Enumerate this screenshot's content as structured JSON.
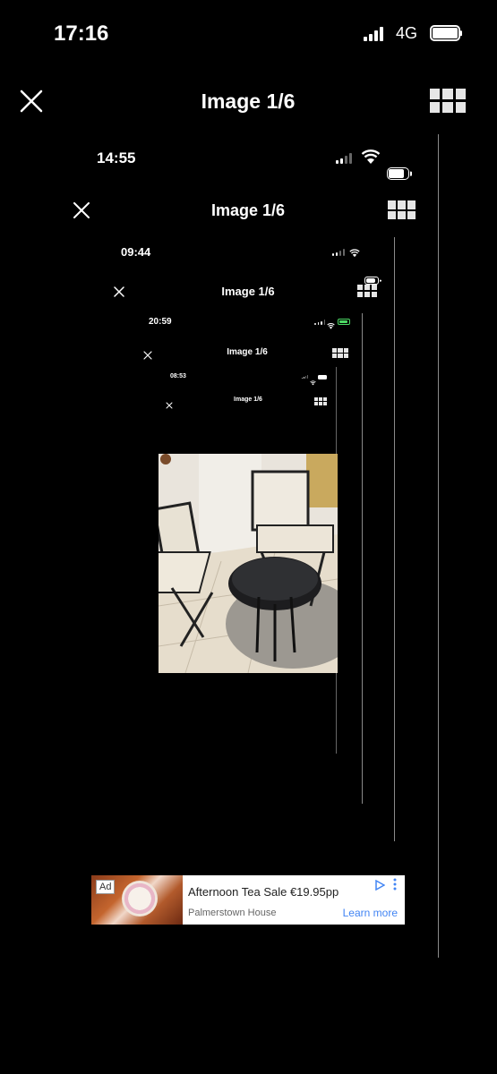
{
  "levels": [
    {
      "time": "17:16",
      "network": "4G",
      "title": "Image 1/6"
    },
    {
      "time": "14:55",
      "title": "Image 1/6"
    },
    {
      "time": "09:44",
      "title": "Image 1/6"
    },
    {
      "time": "20:59",
      "title": "Image 1/6"
    },
    {
      "time": "08:53",
      "title": "Image 1/6"
    }
  ],
  "icons": {
    "close": "close-icon",
    "grid": "grid-icon",
    "signal": "signal-icon",
    "wifi": "wifi-icon",
    "battery": "battery-icon",
    "ad_choices": "ad-choices-icon",
    "ad_menu": "more-vertical-icon"
  },
  "photo": {
    "subject": "two folding chairs and a small round metal side table on a tiled floor"
  },
  "ad": {
    "tag": "Ad",
    "headline": "Afternoon Tea Sale €19.95pp",
    "advertiser": "Palmerstown House",
    "cta": "Learn more"
  },
  "colors": {
    "background": "#000000",
    "ad_link": "#4285f4"
  }
}
